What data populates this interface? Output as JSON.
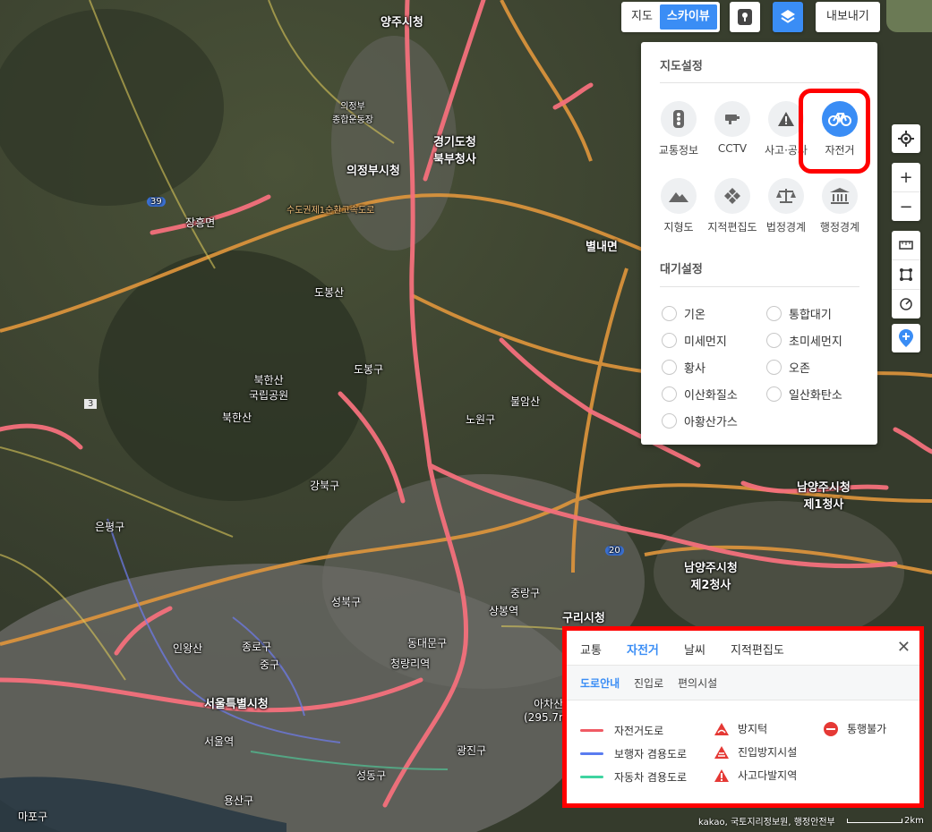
{
  "toolbar": {
    "map_type_options": [
      "지도",
      "스카이뷰"
    ],
    "active_map_type": "스카이뷰",
    "export_label": "내보내기",
    "roadview_icon": "pin-icon",
    "layers_icon": "layers-icon"
  },
  "map_labels": {
    "yangju": "양주시청",
    "uijeongbu_sports": "의정부\n종합운동장",
    "uijeongbu_city": "의정부시청",
    "gyeonggi_north": "경기도청\n북부청사",
    "jangheung": "장흥면",
    "sudogwon_exp": "수도권제1순환고속도로",
    "dobongsan": "도봉산",
    "bukhansan_park": "북한산\n국립공원",
    "bukhansan": "북한산",
    "bulamsan": "불암산",
    "byeollae": "별내면",
    "namyangju1": "남양주시청\n제1청사",
    "namyangju2": "남양주시청\n제2청사",
    "guri": "구리시청",
    "seoul": "서울특별시청",
    "gangbuk": "강북구",
    "dobong": "도봉구",
    "nowon": "노원구",
    "seongbuk": "성북구",
    "jongno": "종로구",
    "jung": "중구",
    "dongdaemun": "동대문구",
    "jungnang": "중랑구",
    "gwangjin": "광진구",
    "seongdong": "성동구",
    "yongsan": "용산구",
    "mapo": "마포구",
    "eunpyeong": "은평구",
    "inwangsan": "인왕산",
    "achasan": "아차산\n(295.7m)",
    "seoul_station": "서울역",
    "cheongnyangni": "청량리역",
    "sangbong": "상봉역",
    "route39": "39",
    "route20": "20",
    "route3": "3"
  },
  "settings_panel": {
    "map_settings_title": "지도설정",
    "layers": [
      {
        "label": "교통정보",
        "icon": "traffic-light-icon"
      },
      {
        "label": "CCTV",
        "icon": "cctv-icon"
      },
      {
        "label": "사고·공사",
        "icon": "warning-icon"
      },
      {
        "label": "자전거",
        "icon": "bicycle-icon",
        "selected": true
      },
      {
        "label": "지형도",
        "icon": "mountain-icon"
      },
      {
        "label": "지적편집도",
        "icon": "cadastral-icon"
      },
      {
        "label": "법정경계",
        "icon": "scale-icon"
      },
      {
        "label": "행정경계",
        "icon": "building-icon"
      }
    ],
    "air_settings_title": "대기설정",
    "air_options": [
      "기온",
      "통합대기",
      "미세먼지",
      "초미세먼지",
      "황사",
      "오존",
      "이산화질소",
      "일산화탄소",
      "아황산가스"
    ]
  },
  "legend_panel": {
    "tabs": [
      "교통",
      "자전거",
      "날씨",
      "지적편집도"
    ],
    "active_tab": "자전거",
    "subtabs": [
      "도로안내",
      "진입로",
      "편의시설"
    ],
    "active_subtab": "도로안내",
    "lines": [
      {
        "label": "자전거도로",
        "color": "#f05a64"
      },
      {
        "label": "보행자 겸용도로",
        "color": "#5a7cf0"
      },
      {
        "label": "자동차 겸용도로",
        "color": "#3fd4a0"
      }
    ],
    "markers": [
      {
        "label": "방지턱",
        "icon": "bump-warning-icon"
      },
      {
        "label": "진입방지시설",
        "icon": "barrier-warning-icon"
      },
      {
        "label": "사고다발지역",
        "icon": "accident-warning-icon"
      },
      {
        "label": "통행불가",
        "icon": "no-entry-icon"
      }
    ]
  },
  "attribution": "kakao, 국토지리정보원, 행정안전부",
  "scale_label": "2km",
  "colors": {
    "accent": "#3a8df5",
    "highlight": "#ff0000",
    "bike_road": "#f05a64"
  }
}
